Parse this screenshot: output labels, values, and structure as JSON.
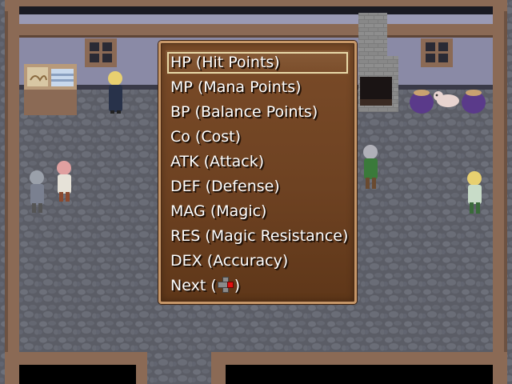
{
  "colors": {
    "floor": "#5b5d66",
    "wall": "#8a8aa6",
    "wood": "#8b6a55",
    "menu_bg": "#6e4222",
    "menu_border": "#c79768",
    "text": "#ffffff"
  },
  "menu": {
    "selected_index": 0,
    "items": [
      {
        "label": "HP (Hit Points)"
      },
      {
        "label": "MP (Mana Points)"
      },
      {
        "label": "BP (Balance Points)"
      },
      {
        "label": "Co (Cost)"
      },
      {
        "label": "ATK (Attack)"
      },
      {
        "label": "DEF (Defense)"
      },
      {
        "label": "MAG (Magic)"
      },
      {
        "label": "RES (Magic Resistance)"
      },
      {
        "label": "DEX (Accuracy)"
      }
    ],
    "next": {
      "prefix": "Next (",
      "suffix": ")",
      "icon": "dpad-right-icon"
    }
  }
}
